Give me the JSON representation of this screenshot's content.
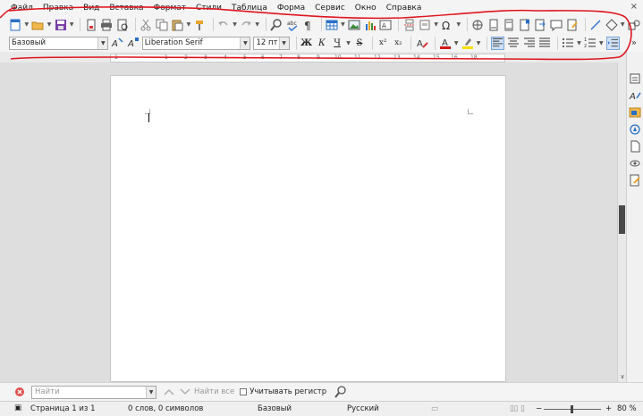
{
  "menu": [
    "Файл",
    "Правка",
    "Вид",
    "Вставка",
    "Формат",
    "Стили",
    "Таблица",
    "Форма",
    "Сервис",
    "Окно",
    "Справка"
  ],
  "menu_close": "×",
  "formatting": {
    "paragraph_style": "Базовый",
    "font_name": "Liberation Serif",
    "font_size": "12 пт",
    "bold": "Ж",
    "italic": "К",
    "underline": "Ч",
    "strike": "S",
    "superscript": "x²",
    "subscript": "x₂",
    "more": "»"
  },
  "ruler_numbers": [
    "1",
    "1",
    "2",
    "3",
    "4",
    "5",
    "6",
    "7",
    "8",
    "9",
    "10",
    "11",
    "12",
    "13",
    "14",
    "15",
    "16",
    "18"
  ],
  "find": {
    "placeholder": "Найти",
    "find_all": "Найти все",
    "match_case": "Учитывать регистр"
  },
  "status": {
    "page": "Страница 1 из 1",
    "words": "0 слов, 0 символов",
    "style": "Базовый",
    "language": "Русский",
    "zoom": "80 %",
    "zoom_minus": "−",
    "zoom_plus": "+"
  },
  "colors": {
    "annotation": "#e0141e",
    "accent": "#2a6fc9",
    "font_color": "#d01818",
    "highlight": "#f6e000"
  }
}
